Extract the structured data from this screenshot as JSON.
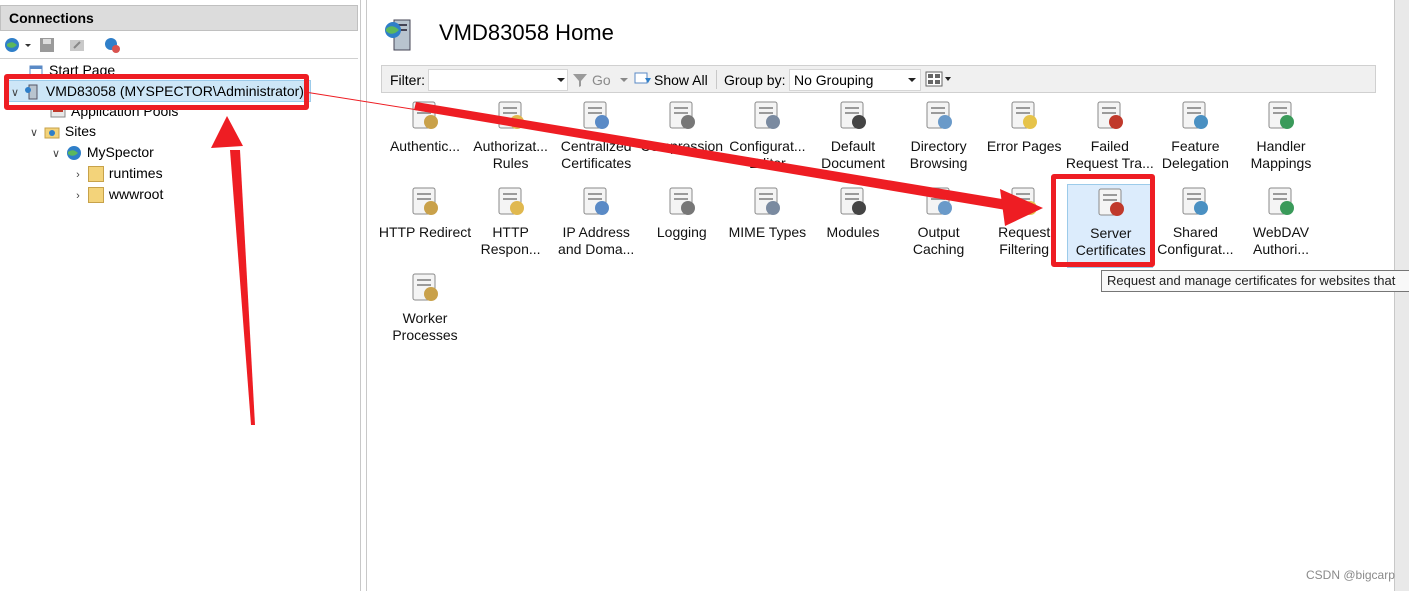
{
  "connections": {
    "header": "Connections",
    "tree": {
      "start_page": "Start Page",
      "server": "VMD83058 (MYSPECTOR\\Administrator)",
      "app_pools": "Application Pools",
      "sites": "Sites",
      "site": "MySpector",
      "folders": [
        "runtimes",
        "wwwroot"
      ]
    }
  },
  "main": {
    "title": "VMD83058 Home",
    "filter_label": "Filter:",
    "go_label": "Go",
    "show_all_label": "Show All",
    "group_by_label": "Group by:",
    "group_by_value": "No Grouping",
    "features_row1": [
      "Authentic...",
      "Authorizat... Rules",
      "Centralized Certificates",
      "Compression",
      "Configurat... Editor",
      "Default Document",
      "Directory Browsing",
      "Error Pages",
      "Failed Request Tra...",
      "Feature Delegation",
      "Handler Mappings"
    ],
    "features_row2": [
      "HTTP Redirect",
      "HTTP Respon...",
      "IP Address and Doma...",
      "Logging",
      "MIME Types",
      "Modules",
      "Output Caching",
      "Request Filtering",
      "Server Certificates",
      "Shared Configurat...",
      "WebDAV Authori..."
    ],
    "features_row3": [
      "Worker Processes"
    ],
    "tooltip": "Request and manage certificates for websites that"
  },
  "watermark": "CSDN @bigcarp",
  "colors": {
    "annotation_red": "#ee1d23",
    "selection_blue": "#cde6f7"
  }
}
